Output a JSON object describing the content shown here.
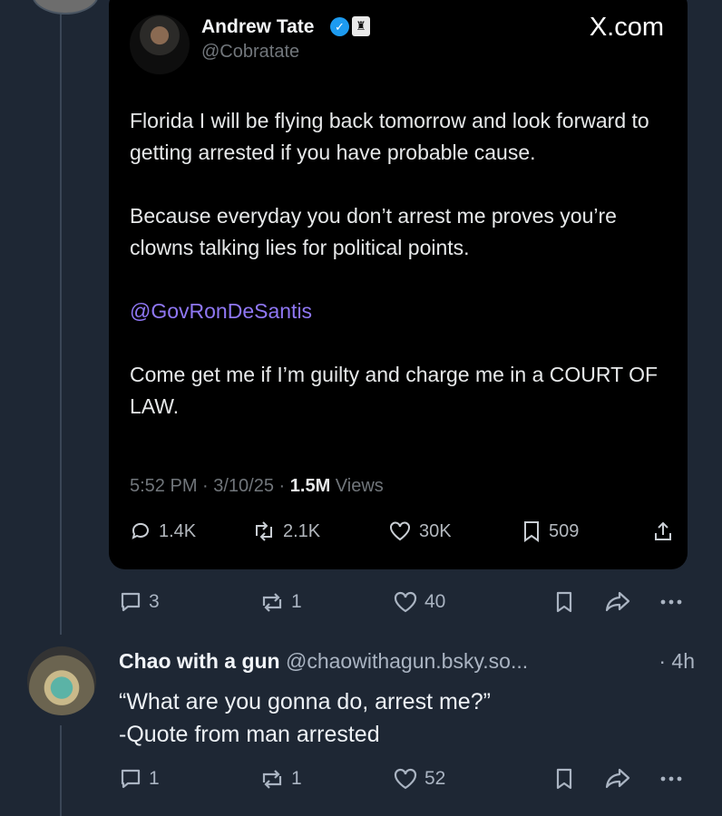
{
  "embed": {
    "author_name": "Andrew Tate",
    "author_handle": "@Cobratate",
    "site": "X.com",
    "paragraphs": [
      "Florida I will be flying back tomorrow and look forward to getting arrested if you have probable cause.",
      "Because everyday you don’t arrest me proves you’re clowns talking lies for political points."
    ],
    "mention": "@GovRonDeSantis",
    "closing": "Come get me if I’m guilty and charge me in a COURT OF LAW.",
    "meta_time": "5:52 PM · 3/10/25 · ",
    "meta_views": "1.5M",
    "meta_views_label": " Views",
    "stats": {
      "replies": "1.4K",
      "reposts": "2.1K",
      "likes": "30K",
      "bookmarks": "509"
    }
  },
  "post1_actions": {
    "replies": "3",
    "reposts": "1",
    "likes": "40"
  },
  "post2": {
    "name": "Chao with a gun",
    "handle": "@chaowithagun.bsky.so...",
    "time": "· 4h",
    "lines": [
      "“What are you gonna do, arrest me?”",
      "-Quote from man arrested"
    ],
    "actions": {
      "replies": "1",
      "reposts": "1",
      "likes": "52"
    }
  },
  "colors": {
    "background": "#1e2734",
    "mention": "#8f77f4",
    "verified": "#1d9bf0"
  }
}
